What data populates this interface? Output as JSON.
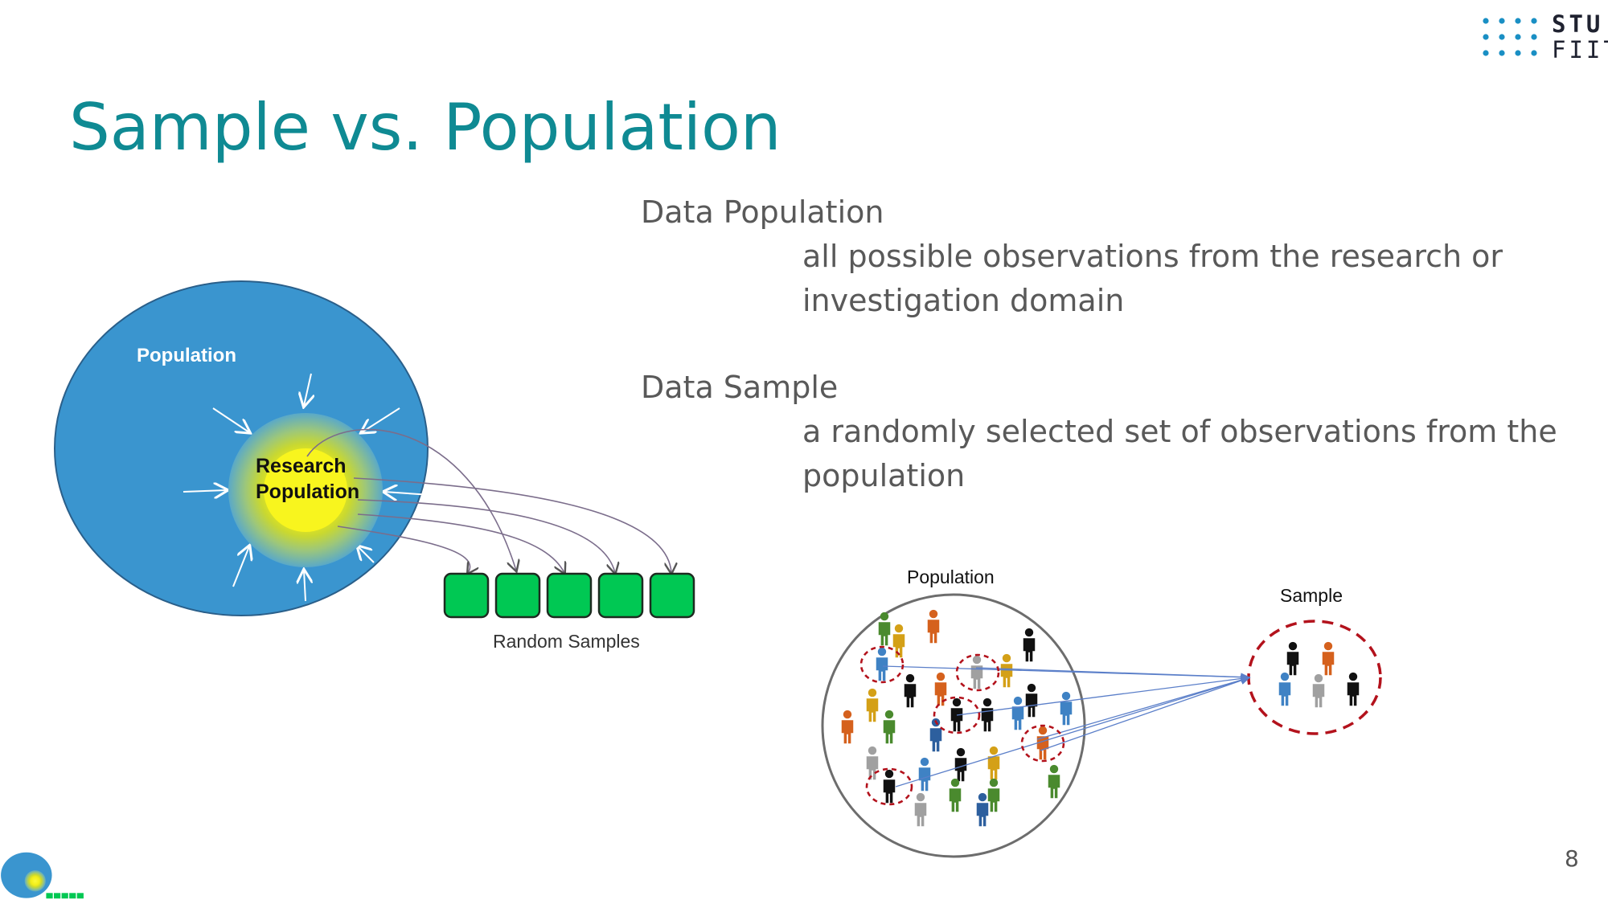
{
  "logo": {
    "line1": "STU",
    "line2": "FIIT",
    "dot_color": "#1a8fc4"
  },
  "title": "Sample vs. Population",
  "definitions": [
    {
      "term": "Data Population",
      "description": "all possible observations from the research or investigation domain"
    },
    {
      "term": "Data Sample",
      "description": "a randomly selected set of observations from the population"
    }
  ],
  "left_diagram": {
    "population_label": "Population",
    "research_label_line1": "Research",
    "research_label_line2": "Population",
    "samples_label": "Random Samples",
    "sample_count": 5,
    "colors": {
      "population": "#3a95cf",
      "research_core": "#f7f21a",
      "sample_box": "#00c853"
    }
  },
  "right_diagram": {
    "population_label": "Population",
    "sample_label": "Sample"
  },
  "page_number": "8",
  "colors": {
    "title": "#0f8a93",
    "text": "#595959"
  }
}
